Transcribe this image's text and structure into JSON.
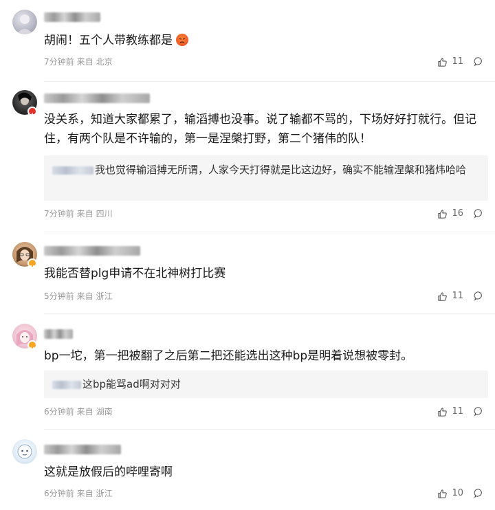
{
  "comments": [
    {
      "text": "胡闹！五个人带教练都是",
      "emoji": "angry-face-emoji",
      "time": "7分钟前",
      "from": "来自",
      "location": "北京",
      "likes": "11",
      "reply": null
    },
    {
      "text": "没关系，知道大家都累了，输滔搏也没事。说了输都不骂的，下场好好打就行。但记住，有两个队是不许输的，第一是涅槃打野，第二个猪伟的队！",
      "time": "7分钟前",
      "from": "来自",
      "location": "四川",
      "likes": "16",
      "reply": {
        "text": "我也觉得输滔搏无所谓，人家今天打得就是比这边好，确实不能输涅槃和猪炜哈哈"
      }
    },
    {
      "text": "我能否替plg申请不在北神树打比赛",
      "time": "5分钟前",
      "from": "来自",
      "location": "浙江",
      "likes": "11",
      "reply": null
    },
    {
      "text": "bp一坨，第一把被翻了之后第二把还能选出这种bp是明着说想被零封。",
      "time": "6分钟前",
      "from": "来自",
      "location": "湖南",
      "likes": "11",
      "reply": {
        "text": "这bp能骂ad啊对对对"
      }
    },
    {
      "text": "这就是放假后的哔哩寄啊",
      "time": "6分钟前",
      "from": "来自",
      "location": "浙江",
      "likes": "10",
      "reply": null
    }
  ],
  "icons": {
    "like": "thumbs-up-icon",
    "reply": "comment-bubble-icon",
    "vip_badge": "orange-v-badge",
    "red_badge": "red-star-badge"
  },
  "colors": {
    "meta_text": "#999999",
    "reply_bg": "#f5f5f5",
    "vip_orange": "#f5a623",
    "badge_red": "#e0322b"
  }
}
